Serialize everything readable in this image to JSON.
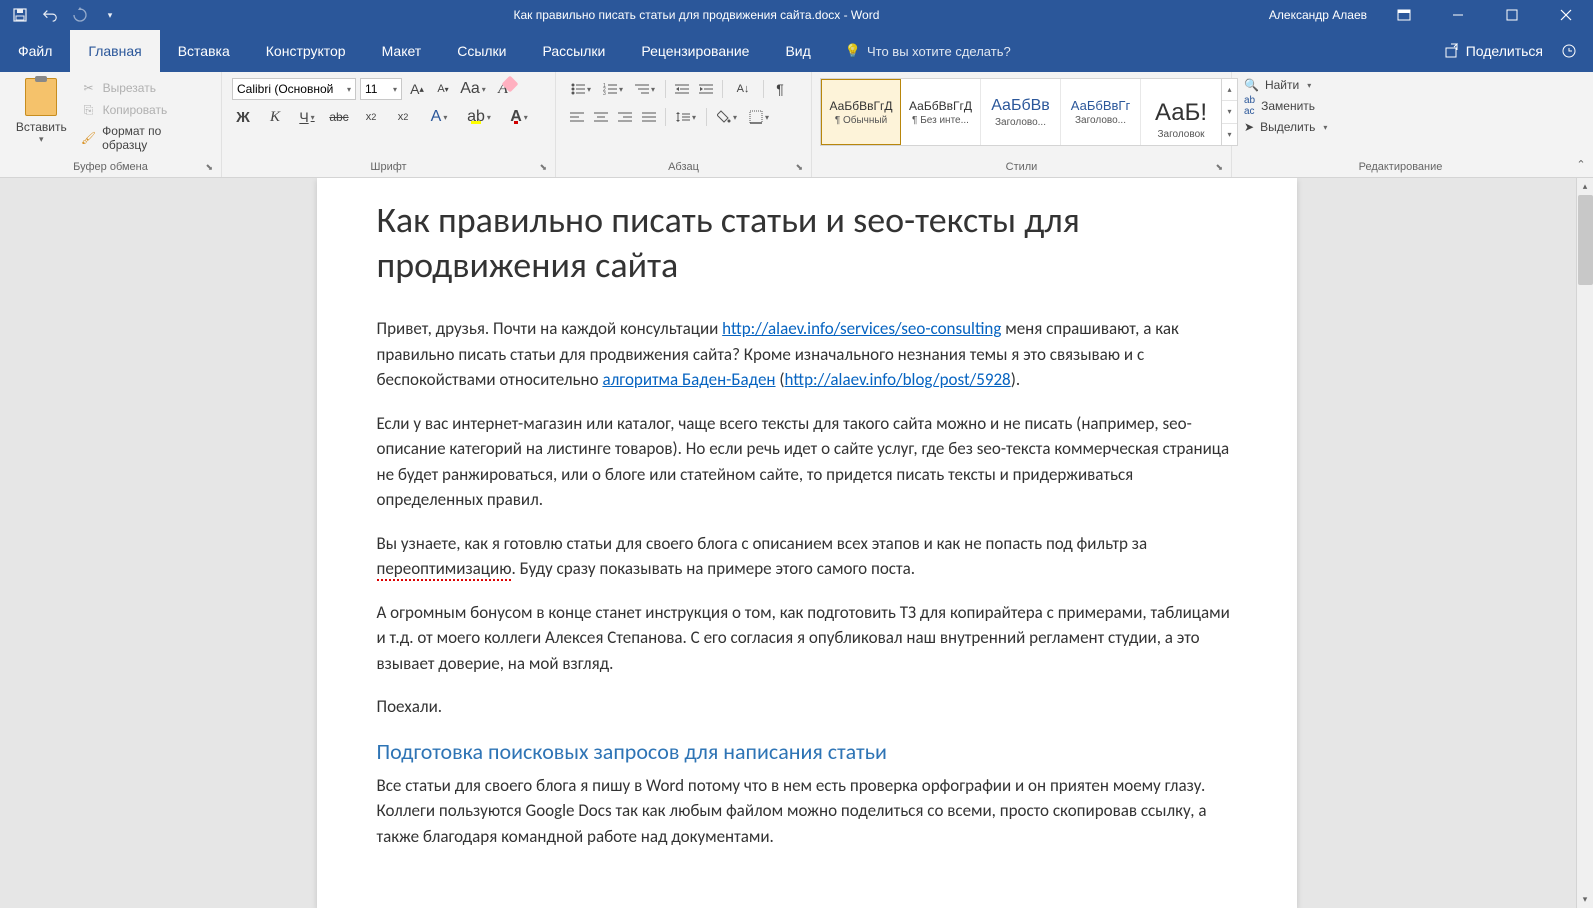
{
  "title": {
    "doc_name": "Как правильно писать статьи для продвижения сайта.docx",
    "app": "Word",
    "full": "Как правильно писать статьи для продвижения сайта.docx  -  Word"
  },
  "user": "Александр Алаев",
  "tabs": {
    "file": "Файл",
    "home": "Главная",
    "insert": "Вставка",
    "design": "Конструктор",
    "layout": "Макет",
    "references": "Ссылки",
    "mailings": "Рассылки",
    "review": "Рецензирование",
    "view": "Вид",
    "tell_me": "Что вы хотите сделать?",
    "share": "Поделиться"
  },
  "clipboard": {
    "paste": "Вставить",
    "cut": "Вырезать",
    "copy": "Копировать",
    "format_painter": "Формат по образцу",
    "group": "Буфер обмена"
  },
  "font": {
    "name": "Calibri (Основной",
    "size": "11",
    "group": "Шрифт"
  },
  "paragraph": {
    "group": "Абзац"
  },
  "styles": {
    "group": "Стили",
    "items": [
      {
        "preview": "АаБбВвГгД",
        "name": "¶ Обычный"
      },
      {
        "preview": "АаБбВвГгД",
        "name": "¶ Без инте..."
      },
      {
        "preview": "АаБбВв",
        "name": "Заголово..."
      },
      {
        "preview": "АаБбВвГг",
        "name": "Заголово..."
      },
      {
        "preview": "АаБ!",
        "name": "Заголовок"
      }
    ]
  },
  "editing": {
    "group": "Редактирование",
    "find": "Найти",
    "replace": "Заменить",
    "select": "Выделить"
  },
  "document": {
    "heading": "Как правильно писать статьи и seo-тексты для продвижения сайта",
    "p1_a": "Привет, друзья. Почти на каждой консультации ",
    "p1_link1": "http://alaev.info/services/seo-consulting",
    "p1_b": " меня спрашивают, а как правильно писать статьи для продвижения сайта? Кроме изначального незнания темы я это связываю и с беспокойствами относительно ",
    "p1_link2": "алгоритма Баден-Баден",
    "p1_c": " (",
    "p1_link3": "http://alaev.info/blog/post/5928",
    "p1_d": ").",
    "p2": "Если у вас интернет-магазин или каталог, чаще всего тексты для такого сайта можно и не писать (например, seo-описание категорий на листинге товаров). Но если речь идет о сайте услуг, где без seo-текста коммерческая страница не будет ранжироваться, или о блоге или статейном сайте, то придется писать тексты и придерживаться определенных правил.",
    "p3_a": "Вы узнаете, как я готовлю статьи для своего блога с описанием всех этапов и как не попасть под фильтр за ",
    "p3_err": "переоптимизацию",
    "p3_b": ". Буду сразу показывать на примере этого самого поста.",
    "p4": "А огромным бонусом в конце станет инструкция о том, как подготовить ТЗ для копирайтера с примерами, таблицами и т.д. от моего коллеги Алексея Степанова. С его согласия я опубликовал наш внутренний регламент студии, а это взывает доверие, на мой взгляд.",
    "p5": "Поехали.",
    "h2": "Подготовка поисковых запросов для написания статьи",
    "p6": "Все статьи для своего блога я пишу в Word потому что в нем есть проверка орфографии и он приятен моему глазу. Коллеги пользуются Google Docs так как любым файлом можно поделиться со всеми, просто скопировав ссылку, а также благодаря командной работе над документами."
  }
}
